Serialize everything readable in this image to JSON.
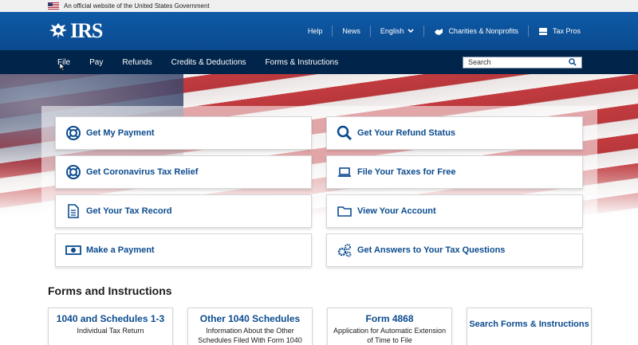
{
  "banner": {
    "text": "An official website of the United States Government"
  },
  "header": {
    "logo_text": "IRS",
    "links": [
      {
        "label": "Help"
      },
      {
        "label": "News"
      },
      {
        "label": "English"
      },
      {
        "label": "Charities & Nonprofits"
      },
      {
        "label": "Tax Pros"
      }
    ]
  },
  "nav": {
    "items": [
      "File",
      "Pay",
      "Refunds",
      "Credits & Deductions",
      "Forms & Instructions"
    ],
    "search_placeholder": "Search"
  },
  "cards": [
    {
      "label": "Get My Payment",
      "icon": "lifebuoy-icon"
    },
    {
      "label": "Get Your Refund Status",
      "icon": "magnifier-icon"
    },
    {
      "label": "Get Coronavirus Tax Relief",
      "icon": "lifebuoy-icon"
    },
    {
      "label": "File Your Taxes for Free",
      "icon": "laptop-icon"
    },
    {
      "label": "Get Your Tax Record",
      "icon": "document-icon"
    },
    {
      "label": "View Your Account",
      "icon": "folder-icon"
    },
    {
      "label": "Make a Payment",
      "icon": "dollar-bill-icon"
    },
    {
      "label": "Get Answers to Your Tax Questions",
      "icon": "gears-icon"
    }
  ],
  "forms": {
    "title": "Forms and Instructions",
    "items": [
      {
        "title": "1040 and Schedules 1-3",
        "desc": "Individual Tax Return"
      },
      {
        "title": "Other 1040 Schedules",
        "desc": "Information About the Other Schedules Filed With Form 1040"
      },
      {
        "title": "Form 4868",
        "desc": "Application for Automatic Extension of Time to File"
      },
      {
        "title": "Search Forms & Instructions",
        "desc": ""
      }
    ]
  },
  "colors": {
    "header_blue": "#0b4e96",
    "nav_navy": "#00244a",
    "link_blue": "#0b4b8f"
  }
}
